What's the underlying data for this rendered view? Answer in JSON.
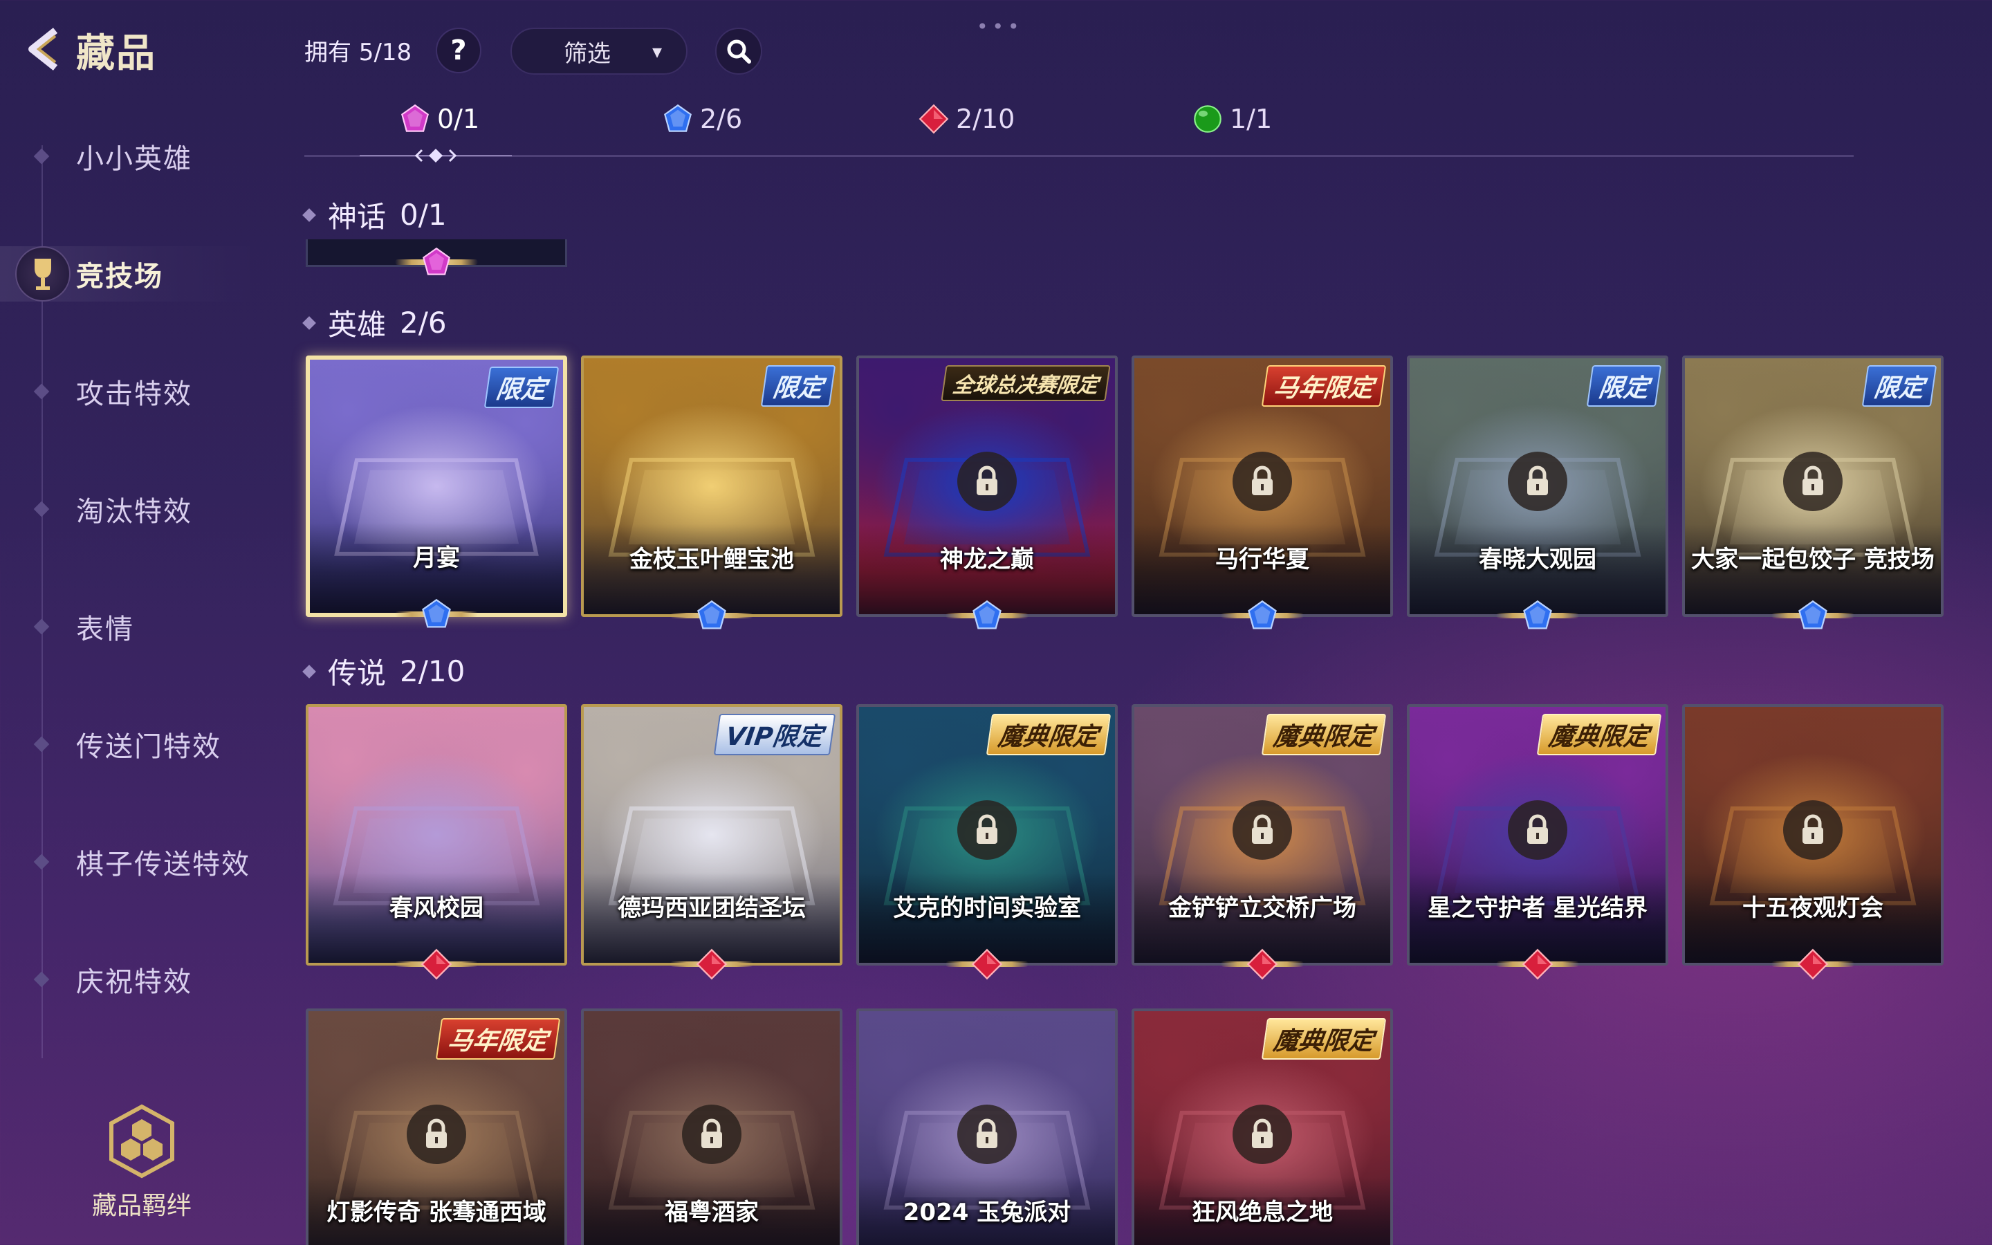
{
  "header": {
    "title": "藏品",
    "owned_text": "拥有 5/18",
    "help_label": "?",
    "filter_label": "筛选",
    "filter_chevron": "⌄"
  },
  "sidebar": {
    "items": [
      {
        "label": "小小英雄"
      },
      {
        "label": "竞技场",
        "active": true
      },
      {
        "label": "攻击特效"
      },
      {
        "label": "淘汰特效"
      },
      {
        "label": "表情"
      },
      {
        "label": "传送门特效"
      },
      {
        "label": "棋子传送特效"
      },
      {
        "label": "庆祝特效"
      }
    ],
    "bond_label": "藏品羁绊"
  },
  "tabs": [
    {
      "gem": "purple",
      "text": "0/1",
      "active": true
    },
    {
      "gem": "blue",
      "text": "2/6"
    },
    {
      "gem": "red",
      "text": "2/10"
    },
    {
      "gem": "green",
      "text": "1/1"
    }
  ],
  "colors": {
    "purple_gem": "#d13ac8",
    "blue_gem": "#2f6ff0",
    "red_gem": "#d81f3c",
    "green_gem": "#1a9a1a",
    "gold_frame": "#b99a50"
  },
  "sections": {
    "mythic": {
      "title": "神话",
      "count": "0/1"
    },
    "epic": {
      "title": "英雄",
      "count": "2/6",
      "cards": [
        {
          "name": "月宴",
          "badge": "限定",
          "badge_style": "blue",
          "owned": true,
          "selected": true,
          "locked": false,
          "art": [
            "#c7b9ef",
            "#7a6ccc",
            "#2c2a66"
          ]
        },
        {
          "name": "金枝玉叶鲤宝池",
          "badge": "限定",
          "badge_style": "blue",
          "owned": true,
          "locked": false,
          "art": [
            "#f1cf74",
            "#b07d2a",
            "#4a3a30"
          ]
        },
        {
          "name": "神龙之巅",
          "badge": "全球总决赛限定",
          "badge_style": "dark",
          "owned": false,
          "locked": true,
          "art": [
            "#1a3bbf",
            "#3d1a6f",
            "#c01c2a"
          ]
        },
        {
          "name": "马行华夏",
          "badge": "马年限定",
          "badge_style": "red",
          "owned": false,
          "locked": true,
          "art": [
            "#c58d4a",
            "#7a4a2a",
            "#3b2418"
          ]
        },
        {
          "name": "春晓大观园",
          "badge": "限定",
          "badge_style": "blue",
          "owned": false,
          "locked": true,
          "art": [
            "#8a9ab0",
            "#5d6c66",
            "#2e3540"
          ]
        },
        {
          "name": "大家一起包饺子 竞技场",
          "badge": "限定",
          "badge_style": "blue",
          "owned": false,
          "locked": true,
          "art": [
            "#d9cba0",
            "#8c7a52",
            "#3e3428"
          ]
        }
      ]
    },
    "legendary": {
      "title": "传说",
      "count": "2/10",
      "cards": [
        {
          "name": "春风校园",
          "badge": "",
          "owned": true,
          "locked": false,
          "art": [
            "#b49ad8",
            "#d88ab0",
            "#4a4a8a"
          ]
        },
        {
          "name": "德玛西亚团结圣坛",
          "badge": "VIP限定",
          "badge_style": "silver",
          "owned": true,
          "locked": false,
          "art": [
            "#e6e6f0",
            "#b8b0a8",
            "#6a6878"
          ]
        },
        {
          "name": "艾克的时间实验室",
          "badge": "魔典限定",
          "badge_style": "gold",
          "owned": false,
          "locked": true,
          "art": [
            "#2a8a80",
            "#1a4a6a",
            "#102a3a"
          ]
        },
        {
          "name": "金铲铲立交桥广场",
          "badge": "魔典限定",
          "badge_style": "gold",
          "owned": false,
          "locked": true,
          "art": [
            "#d08a4a",
            "#6a4a6a",
            "#3a2a3a"
          ]
        },
        {
          "name": "星之守护者 星光结界",
          "badge": "魔典限定",
          "badge_style": "gold",
          "owned": false,
          "locked": true,
          "art": [
            "#4a3aa0",
            "#7a2a9a",
            "#201640"
          ]
        },
        {
          "name": "十五夜观灯会",
          "badge": "",
          "owned": false,
          "locked": true,
          "art": [
            "#c07a3a",
            "#7a3a2a",
            "#2a1a18"
          ]
        },
        {
          "name": "灯影传奇 张骞通西域",
          "badge": "马年限定",
          "badge_style": "red",
          "owned": false,
          "locked": true,
          "art": [
            "#a07a5a",
            "#6a4a40",
            "#30221c"
          ]
        },
        {
          "name": "福粤酒家",
          "badge": "",
          "owned": false,
          "locked": true,
          "art": [
            "#8a6a5a",
            "#5a3a3a",
            "#2a1a1a"
          ]
        },
        {
          "name": "2024 玉兔派对",
          "badge": "",
          "owned": false,
          "locked": true,
          "art": [
            "#9a8ac0",
            "#5a4a8a",
            "#2a2450"
          ]
        },
        {
          "name": "狂风绝息之地",
          "badge": "魔典限定",
          "badge_style": "gold",
          "owned": false,
          "locked": true,
          "art": [
            "#c05a6a",
            "#8a2a3a",
            "#3a1422"
          ]
        }
      ]
    }
  }
}
